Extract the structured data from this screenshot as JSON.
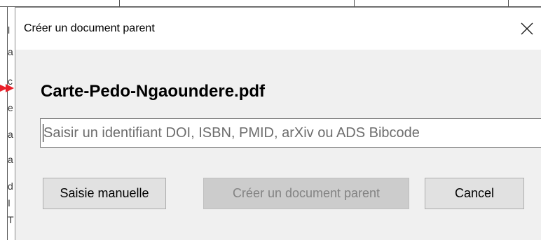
{
  "background": {
    "fragments": [
      "l",
      "a",
      "c",
      "e",
      "a",
      "a",
      "d",
      "I",
      "T"
    ]
  },
  "dialog": {
    "title": "Créer un document parent",
    "close_icon": "close-icon",
    "file_name": "Carte-Pedo-Ngaoundere.pdf",
    "identifier_input": {
      "value": "",
      "placeholder": "Saisir un identifiant DOI, ISBN, PMID, arXiv ou ADS Bibcode"
    },
    "buttons": {
      "manual_label": "Saisie manuelle",
      "create_label": "Créer un document parent",
      "cancel_label": "Cancel"
    }
  },
  "colors": {
    "dialog_bg": "#f0f0f0",
    "titlebar_bg": "#ffffff",
    "arrow": "#e8202a",
    "disabled_text": "#838383"
  }
}
